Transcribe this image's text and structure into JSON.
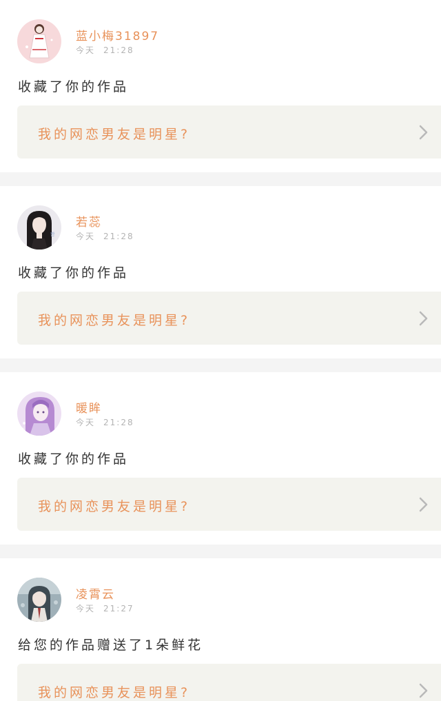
{
  "notifications": [
    {
      "username": "蓝小梅31897",
      "date": "今天",
      "time": "21:28",
      "action": "收藏了你的作品",
      "work_title": "我的网恋男友是明星?",
      "avatar_icon": "avatar-girl-white-dress-icon",
      "avatar_colors": {
        "bg": "#f7d9db",
        "accent": "#e8b4b8"
      }
    },
    {
      "username": "若蕊",
      "date": "今天",
      "time": "21:28",
      "action": "收藏了你的作品",
      "work_title": "我的网恋男友是明星?",
      "avatar_icon": "avatar-girl-long-black-hair-icon",
      "avatar_colors": {
        "bg": "#ebe9ee",
        "accent": "#222222"
      }
    },
    {
      "username": "暖眸",
      "date": "今天",
      "time": "21:28",
      "action": "收藏了你的作品",
      "work_title": "我的网恋男友是明星?",
      "avatar_icon": "avatar-girl-purple-hair-icon",
      "avatar_colors": {
        "bg": "#eddff3",
        "accent": "#b68ad2"
      }
    },
    {
      "username": "凌霄云",
      "date": "今天",
      "time": "21:27",
      "action": "给您的作品赠送了1朵鲜花",
      "work_title": "我的网恋男友是明星?",
      "avatar_icon": "avatar-anime-boy-icon",
      "avatar_colors": {
        "bg": "#9fb0b8",
        "accent": "#5c6d78"
      }
    }
  ],
  "colors": {
    "accent": "#e8925a",
    "box_bg": "#f3f3ee",
    "separator": "#f4f4f4",
    "chevron": "#b9b9b9"
  },
  "chevron_icon": "chevron-right-icon"
}
